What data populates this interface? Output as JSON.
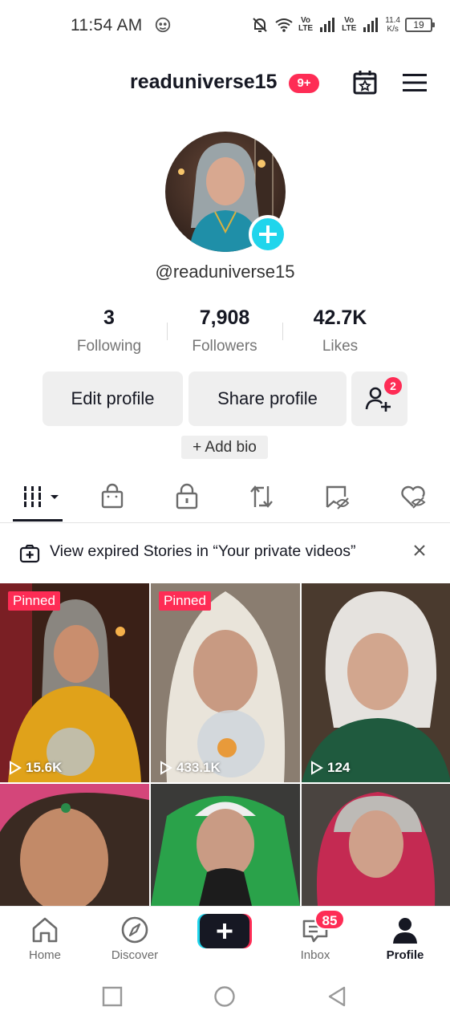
{
  "status_bar": {
    "time": "11:54 AM",
    "volte1": "Vo\nLTE",
    "volte2": "Vo\nLTE",
    "speed_value": "11.4",
    "speed_unit": "K/s",
    "battery": "19"
  },
  "header": {
    "username": "readuniverse15",
    "notification_badge": "9+"
  },
  "profile": {
    "handle": "@readuniverse15",
    "stats": [
      {
        "value": "3",
        "label": "Following"
      },
      {
        "value": "7,908",
        "label": "Followers"
      },
      {
        "value": "42.7K",
        "label": "Likes"
      }
    ],
    "edit_profile_label": "Edit profile",
    "share_profile_label": "Share profile",
    "add_friends_badge": "2",
    "add_bio_label": "+ Add bio"
  },
  "tabs": [
    {
      "name": "videos-grid",
      "active": true
    },
    {
      "name": "shop"
    },
    {
      "name": "private"
    },
    {
      "name": "reposts"
    },
    {
      "name": "favorites"
    },
    {
      "name": "liked"
    }
  ],
  "banner": {
    "text": "View expired Stories in “Your private videos”"
  },
  "videos": [
    {
      "pinned": "Pinned",
      "views": "15.6K"
    },
    {
      "pinned": "Pinned",
      "views": "433.1K"
    },
    {
      "pinned": "",
      "views": "124"
    },
    {
      "pinned": "",
      "views": ""
    },
    {
      "pinned": "",
      "views": ""
    },
    {
      "pinned": "",
      "views": ""
    }
  ],
  "bottom_nav": {
    "home": "Home",
    "discover": "Discover",
    "inbox": "Inbox",
    "inbox_badge": "85",
    "profile": "Profile"
  },
  "colors": {
    "accent": "#fe2c55",
    "cyan": "#20d5ec",
    "text": "#161823"
  }
}
